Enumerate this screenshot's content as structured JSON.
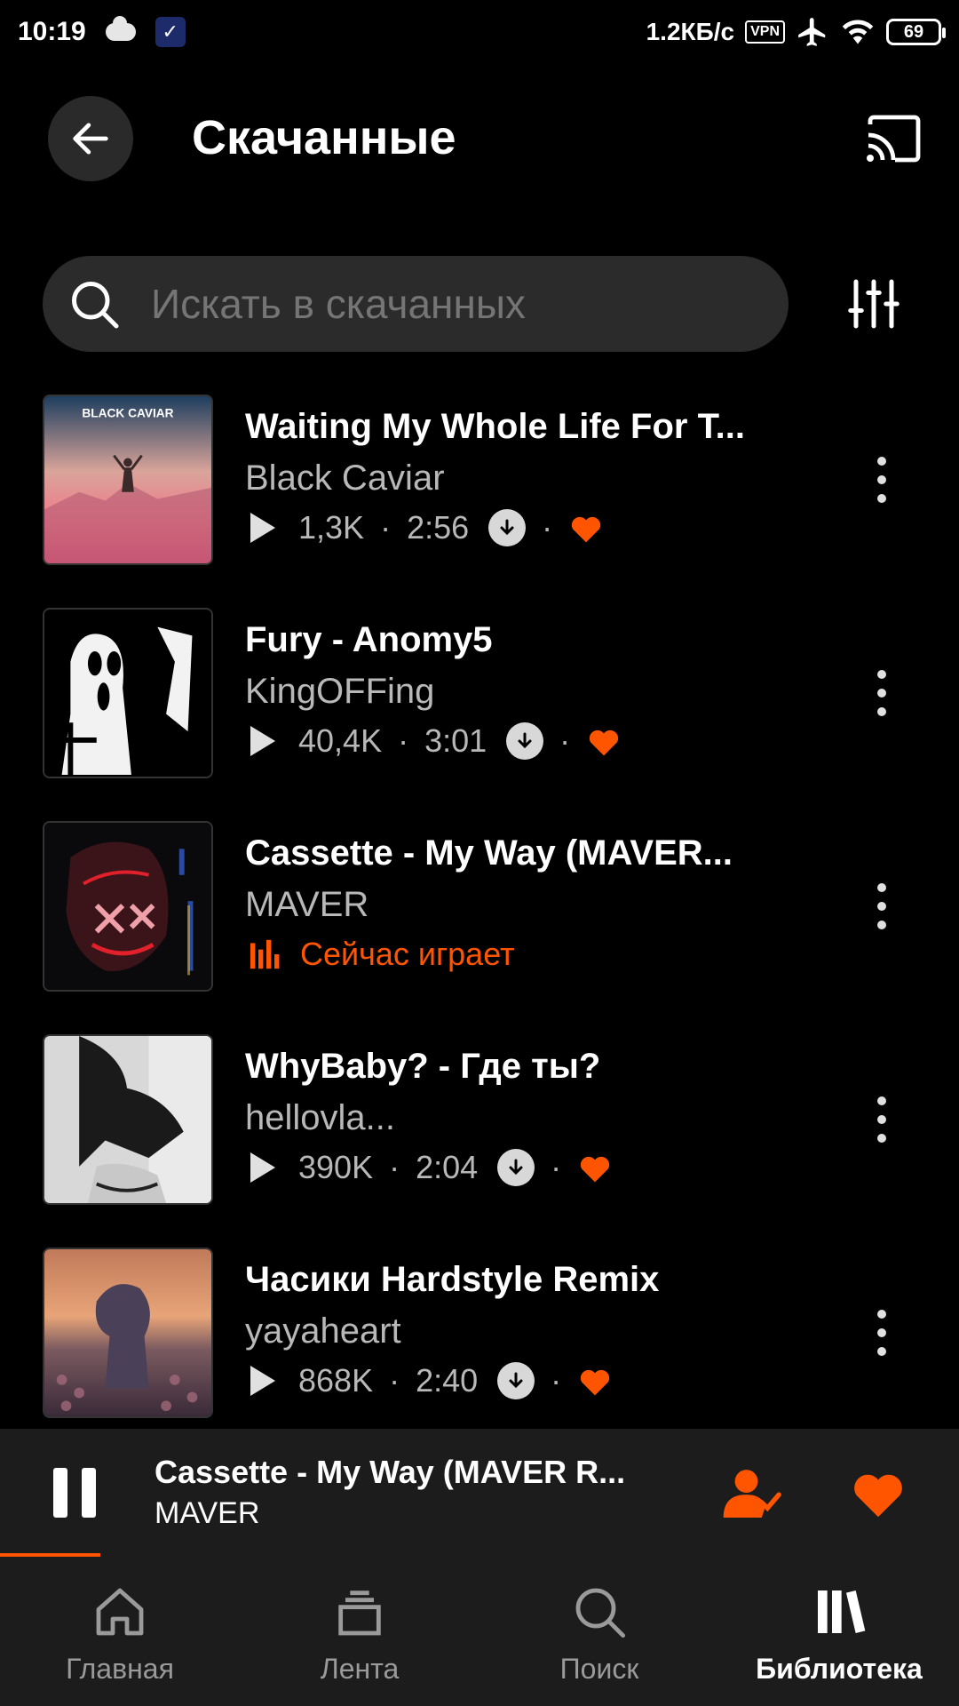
{
  "status_bar": {
    "time": "10:19",
    "speed": "1.2КБ/с",
    "vpn": "VPN",
    "battery": "69"
  },
  "header": {
    "title": "Скачанные"
  },
  "search": {
    "placeholder": "Искать в скачанных"
  },
  "tracks": [
    {
      "title": "Waiting My Whole Life For T...",
      "artist": "Black Caviar",
      "plays": "1,3K",
      "duration": "2:56",
      "liked": true
    },
    {
      "title": "Fury  -  Anomy5",
      "artist": "KingOFFing",
      "plays": "40,4K",
      "duration": "3:01",
      "liked": true
    },
    {
      "title": "Cassette  -  My Way (MAVER...",
      "artist": "MAVER",
      "status": "Сейчас играет"
    },
    {
      "title": "WhyBaby?  -  Где ты?",
      "artist": "hellovla...",
      "plays": "390K",
      "duration": "2:04",
      "liked": true
    },
    {
      "title": "Часики Hardstyle Remix",
      "artist": "yayaheart",
      "plays": "868K",
      "duration": "2:40",
      "liked": true
    }
  ],
  "cover_art": {
    "track_0_text": "BLACK CAVIAR"
  },
  "mini_player": {
    "title": "Cassette  -  My Way (MAVER R...",
    "artist": "MAVER",
    "progress": 0.105
  },
  "bottom_nav": [
    {
      "label": "Главная",
      "icon": "home-icon"
    },
    {
      "label": "Лента",
      "icon": "feed-icon"
    },
    {
      "label": "Поиск",
      "icon": "search-icon"
    },
    {
      "label": "Библиотека",
      "icon": "library-icon",
      "active": true
    }
  ],
  "colors": {
    "accent": "#ff5500",
    "background": "#000000",
    "surface": "#1c1c1c",
    "secondary_text": "#b8b8b8"
  }
}
